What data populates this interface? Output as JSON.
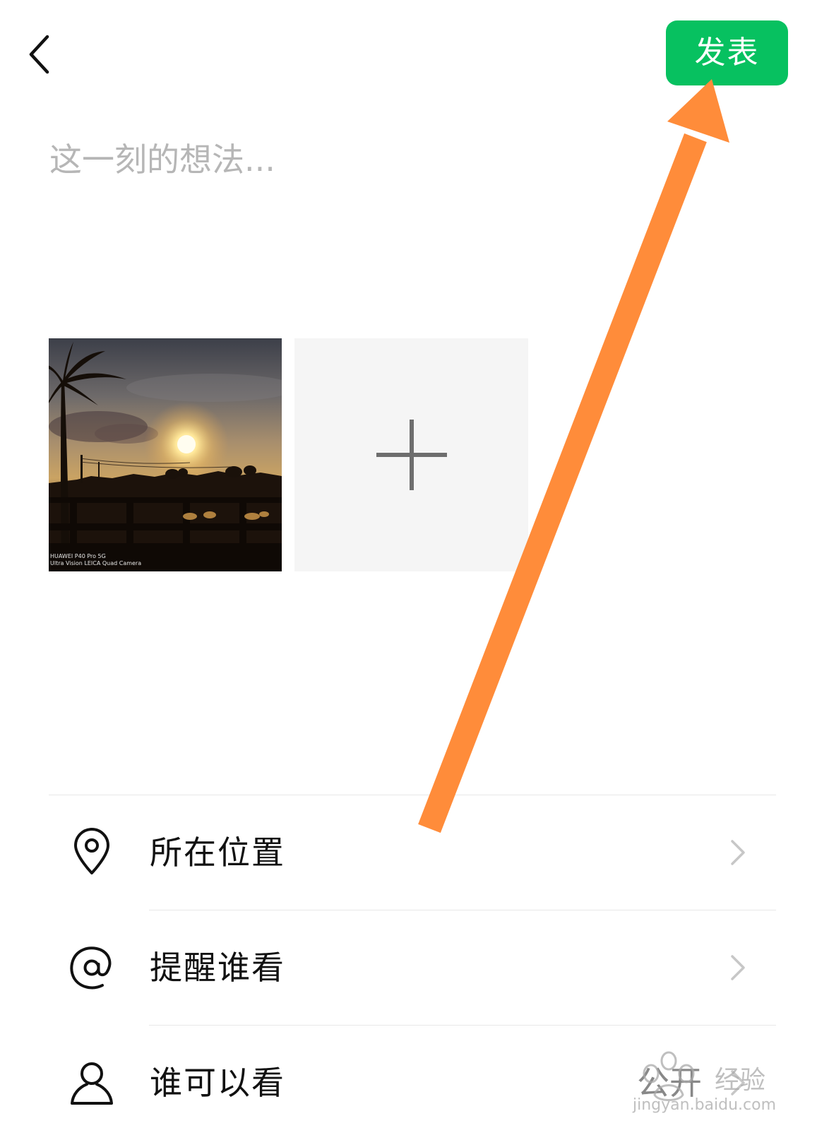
{
  "header": {
    "back_icon": "chevron-left-icon",
    "publish_label": "发表"
  },
  "composer": {
    "placeholder": "这一刻的想法..."
  },
  "photos": {
    "thumbnail_caption_line1": "HUAWEI P40 Pro 5G",
    "thumbnail_caption_line2": "Ultra Vision LEICA Quad Camera",
    "add_icon": "plus-icon"
  },
  "settings": {
    "items": [
      {
        "label": "所在位置",
        "icon": "location-pin-icon",
        "value": ""
      },
      {
        "label": "提醒谁看",
        "icon": "at-sign-icon",
        "value": ""
      },
      {
        "label": "谁可以看",
        "icon": "person-icon",
        "value": "公开"
      }
    ]
  },
  "overlay": {
    "arrow_color": "#ff8c3a",
    "watermark_name": "经验",
    "watermark_url": "jingyan.baidu.com"
  },
  "colors": {
    "accent": "#07c160",
    "placeholder": "#b6b6b6",
    "add_tile_bg": "#f5f5f5"
  }
}
